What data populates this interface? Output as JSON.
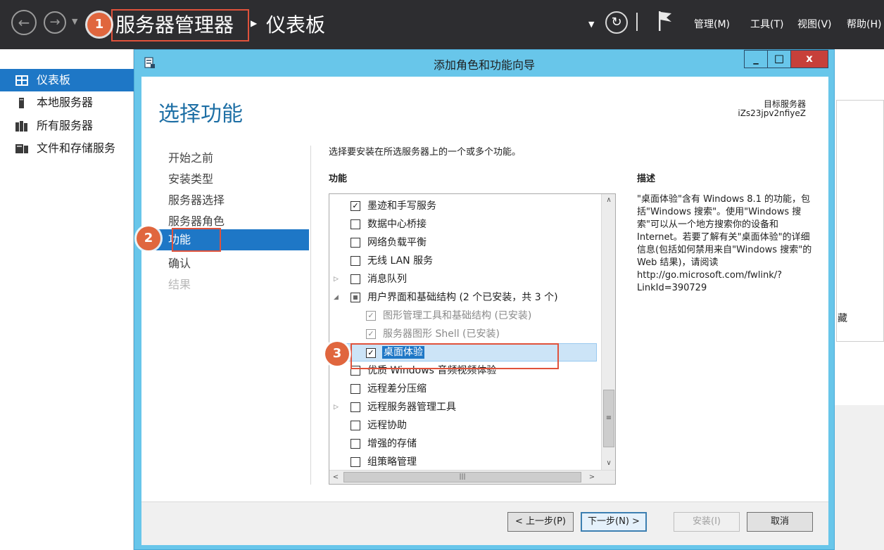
{
  "top_bar": {
    "breadcrumb_root": "服务器管理器",
    "breadcrumb_current": "仪表板",
    "menus": [
      "管理(M)",
      "工具(T)",
      "视图(V)",
      "帮助(H)"
    ]
  },
  "markers": [
    "1",
    "2",
    "3"
  ],
  "sidebar": {
    "items": [
      {
        "label": "仪表板",
        "icon": "dashboard-icon",
        "active": true
      },
      {
        "label": "本地服务器",
        "icon": "local-server-icon"
      },
      {
        "label": "所有服务器",
        "icon": "all-servers-icon"
      },
      {
        "label": "文件和存储服务",
        "icon": "file-storage-icon"
      }
    ]
  },
  "background": {
    "fragment": "藏"
  },
  "wizard": {
    "window_title": "添加角色和功能向导",
    "window_buttons": [
      "_",
      "□",
      "x"
    ],
    "page_title": "选择功能",
    "target_label": "目标服务器",
    "target_value": "iZs23jpv2nfiyeZ",
    "steps": [
      {
        "label": "开始之前"
      },
      {
        "label": "安装类型"
      },
      {
        "label": "服务器选择"
      },
      {
        "label": "服务器角色"
      },
      {
        "label": "功能",
        "active": true
      },
      {
        "label": "确认"
      },
      {
        "label": "结果",
        "disabled": true
      }
    ],
    "instruction": "选择要安装在所选服务器上的一个或多个功能。",
    "features_header": "功能",
    "description_header": "描述",
    "description": "\"桌面体验\"含有 Windows 8.1 的功能，包括\"Windows 搜索\"。使用\"Windows 搜索\"可以从一个地方搜索你的设备和 Internet。若要了解有关\"桌面体验\"的详细信息(包括如何禁用来自\"Windows 搜索\"的 Web 结果)，请阅读 http://go.microsoft.com/fwlink/?LinkId=390729",
    "features": [
      {
        "label": "墨迹和手写服务",
        "checked": true
      },
      {
        "label": "数据中心桥接",
        "checked": false
      },
      {
        "label": "网络负载平衡",
        "checked": false
      },
      {
        "label": "无线 LAN 服务",
        "checked": false
      },
      {
        "label": "消息队列",
        "checked": false,
        "expander": "collapsed"
      },
      {
        "label": "用户界面和基础结构 (2 个已安装，共 3 个)",
        "partial": true,
        "expander": "expanded"
      },
      {
        "label": "图形管理工具和基础结构 (已安装)",
        "checked": true,
        "indent": 1,
        "disabled": true
      },
      {
        "label": "服务器图形 Shell (已安装)",
        "checked": true,
        "indent": 1,
        "disabled": true
      },
      {
        "label": "桌面体验",
        "checked": true,
        "indent": 1,
        "selected": true
      },
      {
        "label": "优质 Windows 音频视频体验",
        "checked": false
      },
      {
        "label": "远程差分压缩",
        "checked": false
      },
      {
        "label": "远程服务器管理工具",
        "checked": false,
        "expander": "collapsed"
      },
      {
        "label": "远程协助",
        "checked": false
      },
      {
        "label": "增强的存储",
        "checked": false
      },
      {
        "label": "组策略管理",
        "checked": false
      }
    ],
    "buttons": {
      "prev": "< 上一步(P)",
      "next": "下一步(N) >",
      "install": "安装(I)",
      "cancel": "取消"
    }
  },
  "colors": {
    "accent": "#1e77c6",
    "annotation": "#e0523b",
    "dialog_frame": "#68c6ea",
    "topbar": "#2d2d30"
  }
}
